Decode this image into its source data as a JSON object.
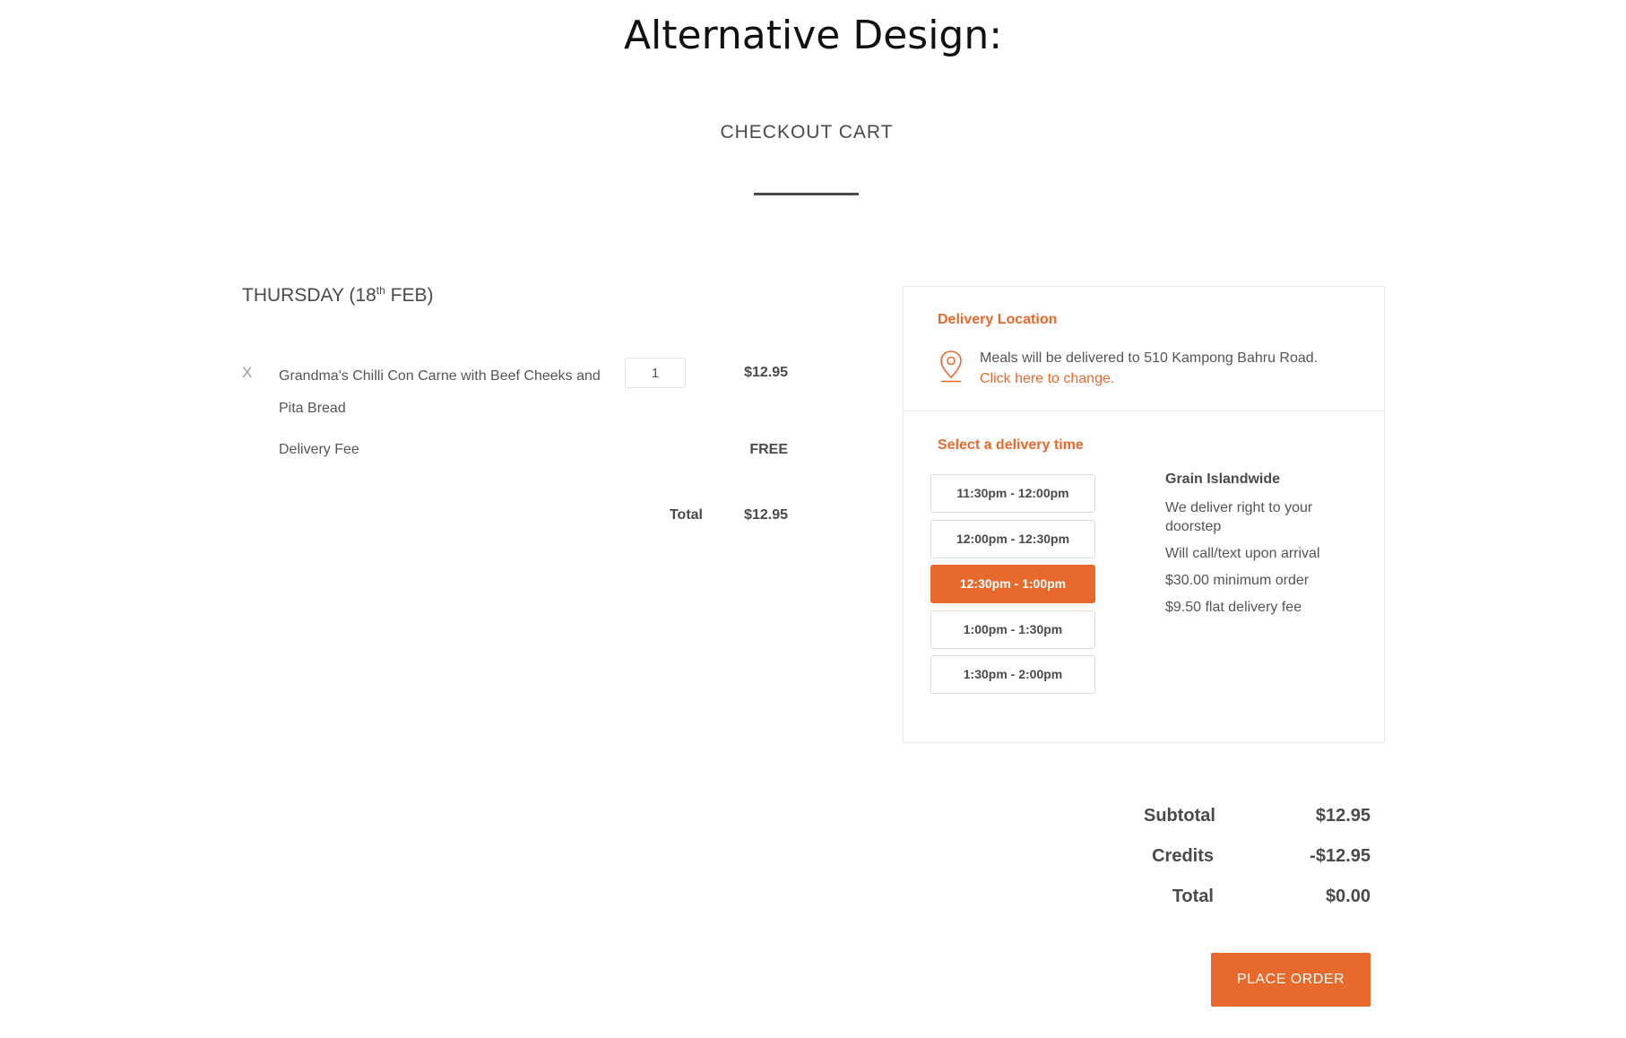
{
  "banner": "Alternative Design:",
  "page_title": "CHECKOUT CART",
  "day": {
    "prefix": "THURSDAY (18",
    "sup": "th",
    "suffix": " FEB)"
  },
  "item": {
    "remove_label": "X",
    "name": "Grandma's Chilli Con Carne with Beef Cheeks and  Pita Bread",
    "quantity": "1",
    "price": "$12.95"
  },
  "delivery_fee": {
    "label": "Delivery Fee",
    "value": "FREE"
  },
  "cart_total": {
    "label": "Total",
    "value": "$12.95"
  },
  "delivery_location": {
    "heading": "Delivery Location",
    "icon": "location-pin-icon",
    "text": "Meals will be delivered to 510 Kampong Bahru Road.",
    "link": "Click here to change."
  },
  "delivery_time": {
    "heading": "Select a delivery time",
    "slots": [
      {
        "label": "11:30pm - 12:00pm",
        "selected": false
      },
      {
        "label": "12:00pm - 12:30pm",
        "selected": false
      },
      {
        "label": "12:30pm - 1:00pm",
        "selected": true
      },
      {
        "label": "1:00pm - 1:30pm",
        "selected": false
      },
      {
        "label": "1:30pm - 2:00pm",
        "selected": false
      }
    ],
    "info": {
      "title": "Grain Islandwide",
      "lines": [
        "We deliver right to your doorstep",
        "Will call/text upon arrival",
        "$30.00 minimum order",
        "$9.50 flat delivery fee"
      ]
    }
  },
  "summary": {
    "subtotal_label": "Subtotal",
    "subtotal_value": "$12.95",
    "credits_label": "Credits",
    "credits_value": "-$12.95",
    "total_label": "Total",
    "total_value": "$0.00"
  },
  "place_order_label": "PLACE ORDER",
  "colors": {
    "accent": "#e8692c",
    "text": "#4a4a4a",
    "border": "#ebebeb"
  }
}
